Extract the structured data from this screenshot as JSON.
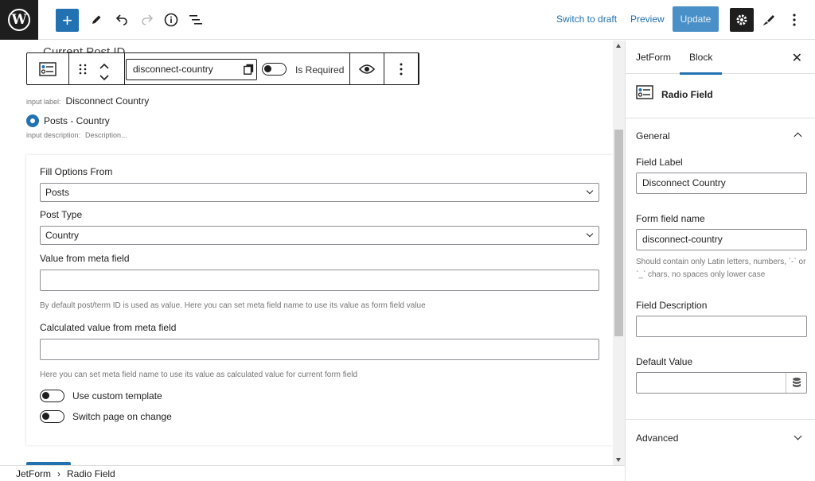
{
  "topbar": {
    "logo_text": "W",
    "add_label": "+",
    "switch_to_draft": "Switch to draft",
    "preview": "Preview",
    "update": "Update",
    "icons": [
      "wordpress-logo",
      "plus-icon",
      "pencil-icon",
      "undo-icon",
      "redo-icon",
      "info-icon",
      "list-view-icon",
      "gear-icon",
      "brush-icon",
      "kebab-icon"
    ]
  },
  "canvas": {
    "previous_block_title": "Current Post ID",
    "block_toolbar": {
      "field_name_value": "disconnect-country",
      "is_required_label": "Is Required"
    },
    "input_label_caption": "input label:",
    "input_label_value": "Disconnect Country",
    "radio_option": "Posts - Country",
    "input_description_caption": "input description:",
    "input_description_placeholder": "Description...",
    "panel": {
      "fill_options_label": "Fill Options From",
      "fill_options_value": "Posts",
      "post_type_label": "Post Type",
      "post_type_value": "Country",
      "value_meta_label": "Value from meta field",
      "value_meta_help": "By default post/term ID is used as value. Here you can set meta field name to use its value as form field value",
      "calc_meta_label": "Calculated value from meta field",
      "calc_meta_help": "Here you can set meta field name to use its value as calculated value for current form field",
      "custom_template_label": "Use custom template",
      "switch_page_label": "Switch page on change"
    }
  },
  "breadcrumb": {
    "root": "JetForm",
    "separator": "›",
    "current": "Radio Field"
  },
  "sidebar": {
    "tab_jetform": "JetForm",
    "tab_block": "Block",
    "close": "✕",
    "block_name": "Radio Field",
    "general_title": "General",
    "field_label_label": "Field Label",
    "field_label_value": "Disconnect Country",
    "form_field_name_label": "Form field name",
    "form_field_name_value": "disconnect-country",
    "form_field_name_help": "Should contain only Latin letters, numbers, `-` or `_` chars, no spaces only lower case",
    "field_description_label": "Field Description",
    "field_description_value": "",
    "default_value_label": "Default Value",
    "default_value_value": "",
    "advanced_title": "Advanced"
  },
  "colors": {
    "accent": "#2271b1",
    "dark": "#1e1e1e",
    "muted": "#757575"
  }
}
